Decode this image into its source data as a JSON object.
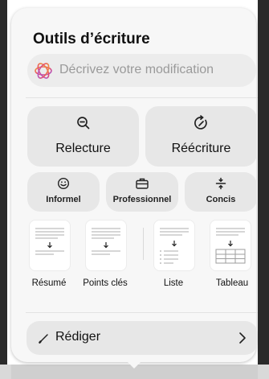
{
  "panel": {
    "title": "Outils d’écriture",
    "describe_placeholder": "Décrivez votre modification"
  },
  "primary_actions": [
    {
      "label": "Relecture",
      "icon": "proofread-magnifier-icon"
    },
    {
      "label": "Réécriture",
      "icon": "rewrite-cycle-icon"
    }
  ],
  "tone_actions": [
    {
      "label": "Informel",
      "icon": "smiley-icon"
    },
    {
      "label": "Professionnel",
      "icon": "briefcase-icon"
    },
    {
      "label": "Concis",
      "icon": "divide-icon"
    }
  ],
  "format_actions": [
    {
      "label": "Résumé",
      "icon": "summary-doc-icon"
    },
    {
      "label": "Points clés",
      "icon": "key-points-doc-icon"
    },
    {
      "label": "Liste",
      "icon": "list-doc-icon"
    },
    {
      "label": "Tableau",
      "icon": "table-doc-icon"
    }
  ],
  "compose": {
    "label": "Rédiger",
    "icon": "pencil-icon"
  },
  "colors": {
    "panel_bg": "#f7f7f7",
    "button_bg": "#e7e7e7",
    "placeholder_text": "#9a9a9a"
  }
}
